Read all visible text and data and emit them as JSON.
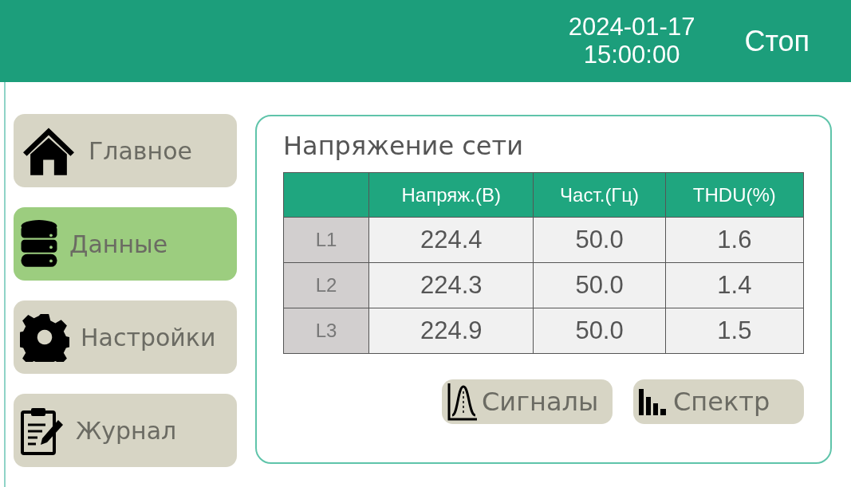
{
  "header": {
    "date": "2024-01-17",
    "time": "15:00:00",
    "status": "Стоп"
  },
  "sidebar": {
    "items": [
      {
        "label": "Главное",
        "selected": false
      },
      {
        "label": "Данные",
        "selected": true
      },
      {
        "label": "Настройки",
        "selected": false
      },
      {
        "label": "Журнал",
        "selected": false
      }
    ]
  },
  "panel": {
    "title": "Напряжение сети",
    "table": {
      "columns": [
        "",
        "Напряж.(В)",
        "Част.(Гц)",
        "THDU(%)"
      ],
      "rows": [
        [
          "L1",
          "224.4",
          "50.0",
          "1.6"
        ],
        [
          "L2",
          "224.3",
          "50.0",
          "1.4"
        ],
        [
          "L3",
          "224.9",
          "50.0",
          "1.5"
        ]
      ]
    },
    "buttons": [
      {
        "label": "Сигналы"
      },
      {
        "label": "Спектр"
      }
    ]
  }
}
